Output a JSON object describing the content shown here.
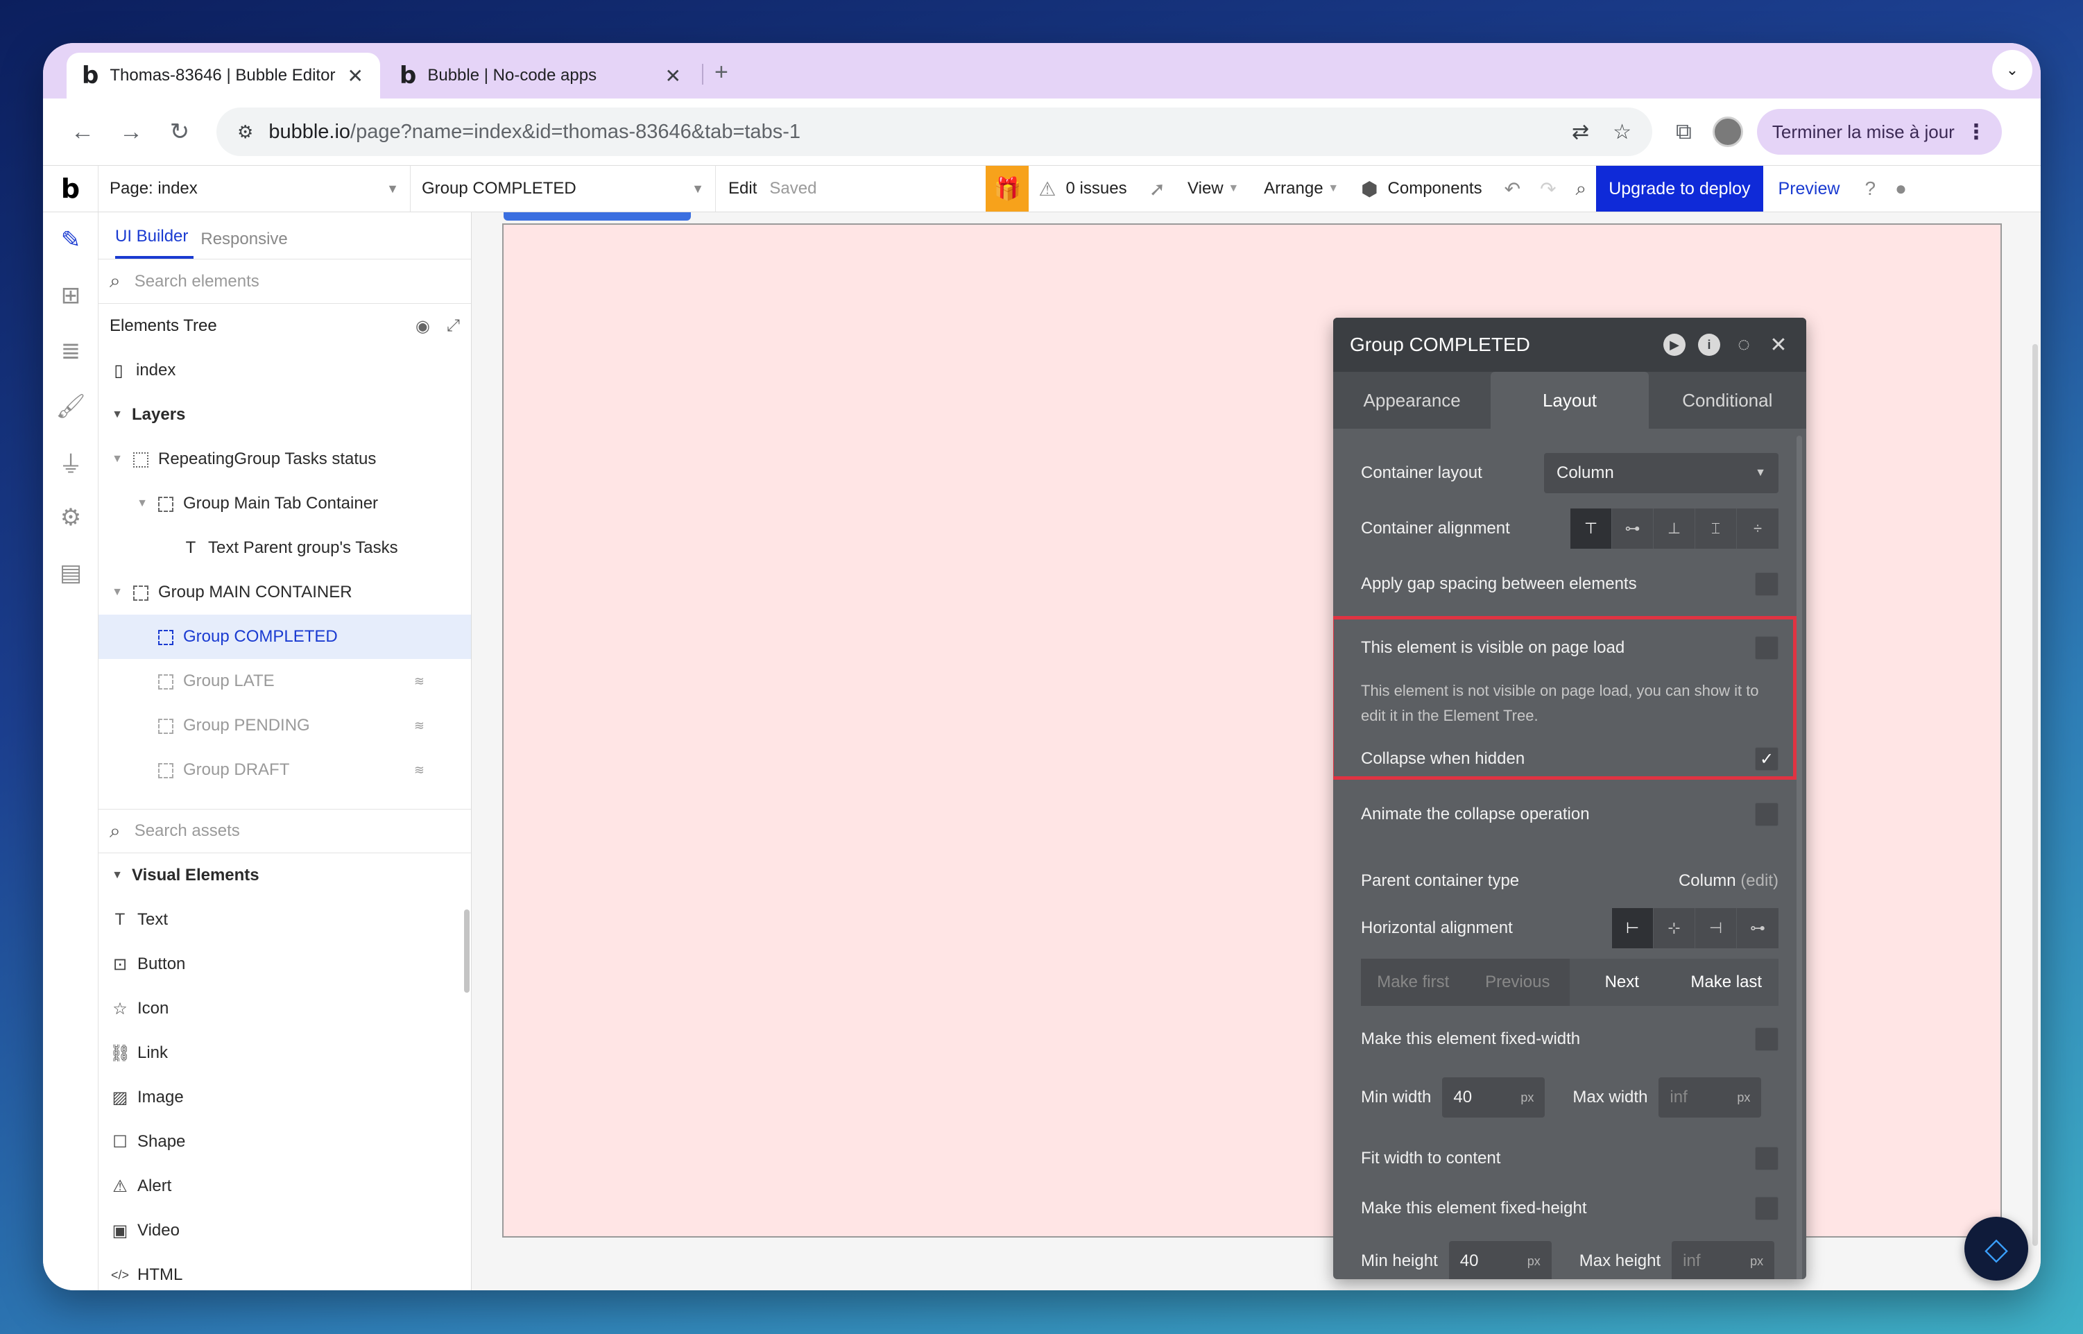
{
  "browser": {
    "tabs": [
      {
        "title": "Thomas-83646 | Bubble Editor",
        "favicon": "b",
        "close": "✕"
      },
      {
        "title": "Bubble | No-code apps",
        "favicon": "b",
        "close": "✕"
      }
    ],
    "new_tab": "+",
    "dropdown": "⌄",
    "url_host": "bubble.io",
    "url_path": "/page?name=index&id=thomas-83646&tab=tabs-1",
    "update_button": "Terminer la mise à jour",
    "update_menu": "⋮"
  },
  "topbar": {
    "logo": "b",
    "page_select": "Page: index",
    "element_select": "Group COMPLETED",
    "edit": "Edit",
    "saved": "Saved",
    "issues": "0 issues",
    "view": "View",
    "arrange": "Arrange",
    "components": "Components",
    "upgrade": "Upgrade to deploy",
    "preview": "Preview"
  },
  "left_panel": {
    "tabs": [
      "UI Builder",
      "Responsive"
    ],
    "search_elements_placeholder": "Search elements",
    "tree_title": "Elements Tree",
    "tree": [
      {
        "label": "index",
        "depth": 0,
        "type": "page"
      },
      {
        "label": "Layers",
        "depth": 0,
        "type": "folder"
      },
      {
        "label": "RepeatingGroup Tasks status",
        "depth": 0,
        "type": "repeating"
      },
      {
        "label": "Group Main Tab Container",
        "depth": 1,
        "type": "group"
      },
      {
        "label": "Text Parent group's Tasks",
        "depth": 2,
        "type": "text"
      },
      {
        "label": "Group MAIN CONTAINER",
        "depth": 0,
        "type": "group"
      },
      {
        "label": "Group COMPLETED",
        "depth": 1,
        "type": "group",
        "selected": true
      },
      {
        "label": "Group LATE",
        "depth": 1,
        "type": "group",
        "hidden": true
      },
      {
        "label": "Group PENDING",
        "depth": 1,
        "type": "group",
        "hidden": true
      },
      {
        "label": "Group DRAFT",
        "depth": 1,
        "type": "group",
        "hidden": true
      }
    ],
    "search_assets_placeholder": "Search assets",
    "visual_elements_title": "Visual Elements",
    "visual_elements": [
      {
        "label": "Text",
        "icon": "T"
      },
      {
        "label": "Button",
        "icon": "⊡"
      },
      {
        "label": "Icon",
        "icon": "☆"
      },
      {
        "label": "Link",
        "icon": "⛓"
      },
      {
        "label": "Image",
        "icon": "▨"
      },
      {
        "label": "Shape",
        "icon": "☐"
      },
      {
        "label": "Alert",
        "icon": "⚠"
      },
      {
        "label": "Video",
        "icon": "▣"
      },
      {
        "label": "HTML",
        "icon": "</>"
      }
    ]
  },
  "editor": {
    "title": "Group COMPLETED",
    "tabs": [
      "Appearance",
      "Layout",
      "Conditional"
    ],
    "container_layout_label": "Container layout",
    "container_layout_value": "Column",
    "container_alignment_label": "Container alignment",
    "gap_label": "Apply gap spacing between elements",
    "visible_label": "This element is visible on page load",
    "visible_hint": "This element is not visible on page load, you can show it to edit it in the Element Tree.",
    "collapse_label": "Collapse when hidden",
    "animate_label": "Animate the collapse operation",
    "parent_type_label": "Parent container type",
    "parent_type_value": "Column",
    "parent_type_edit": "(edit)",
    "horizontal_alignment_label": "Horizontal alignment",
    "order_buttons": [
      "Make first",
      "Previous",
      "Next",
      "Make last"
    ],
    "fixed_width_label": "Make this element fixed-width",
    "min_width_label": "Min width",
    "min_width_value": "40",
    "max_width_label": "Max width",
    "max_width_placeholder": "inf",
    "unit": "px",
    "fit_width_label": "Fit width to content",
    "fixed_height_label": "Make this element fixed-height",
    "min_height_label": "Min height",
    "min_height_value": "40",
    "max_height_label": "Max height",
    "max_height_placeholder": "inf",
    "highlight_color": "#e03342"
  }
}
